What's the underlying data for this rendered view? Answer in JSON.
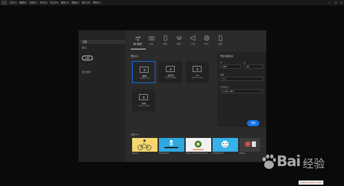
{
  "menubar": {
    "items": [
      "文件(F)",
      "编辑(E)",
      "剪辑(C)",
      "序列(S)",
      "标记(M)",
      "图形(G)",
      "视图(V)",
      "窗口(W)",
      "帮助(H)"
    ],
    "window_controls": [
      "—",
      "□",
      "✕"
    ]
  },
  "dialog": {
    "left_nav": {
      "items": [
        "主页",
        "学习"
      ],
      "create_button": "CDR",
      "recent_label": "最近使用"
    },
    "categories": [
      {
        "label": "热门",
        "icon": "social-icon"
      },
      {
        "label": "社交",
        "icon": "camera-icon"
      },
      {
        "label": "移动",
        "icon": "mobile-icon"
      },
      {
        "label": "教育",
        "icon": "graduation-cap-icon"
      },
      {
        "label": "广告",
        "icon": "megaphone-icon"
      },
      {
        "label": "Web",
        "icon": "globe-icon"
      },
      {
        "label": "文档",
        "icon": "document-icon"
      }
    ],
    "active_category_label": "热门启动",
    "presets_title": "预设(4)",
    "presets": [
      {
        "name": "横屏",
        "size": "1280 x 720"
      },
      {
        "name": "全高清",
        "size": "1920 x 1080"
      },
      {
        "name": "4K",
        "size": "3840 x 2160"
      },
      {
        "name": "纵向",
        "size": "1080 x 1920"
      }
    ],
    "details": {
      "title": "预设详细信息",
      "width_label": "宽",
      "width_value": "1280",
      "height_label": "高",
      "height_value": "720",
      "unit_label": "像素",
      "unit_value": "像素",
      "format_label": "文件格式",
      "format_value": "H.264 / MP4",
      "create_button": "创建"
    },
    "templates_title": "模板(32)",
    "templates": [
      {
        "name": "Bicycle",
        "bg": "#f5d76e"
      },
      {
        "name": "Skateboard",
        "bg": "#2fa8e0"
      },
      {
        "name": "Happy Paddy Day Dance",
        "bg": "#f2f2f2"
      },
      {
        "name": "Compliment",
        "bg": "#35b3e8"
      },
      {
        "name": "Bowie",
        "bg": "#3c3c3c"
      }
    ],
    "templates_more": "›"
  },
  "watermark": {
    "text": "Bai",
    "text_cn": "经验",
    "url": "jingyan.baidu.com"
  }
}
